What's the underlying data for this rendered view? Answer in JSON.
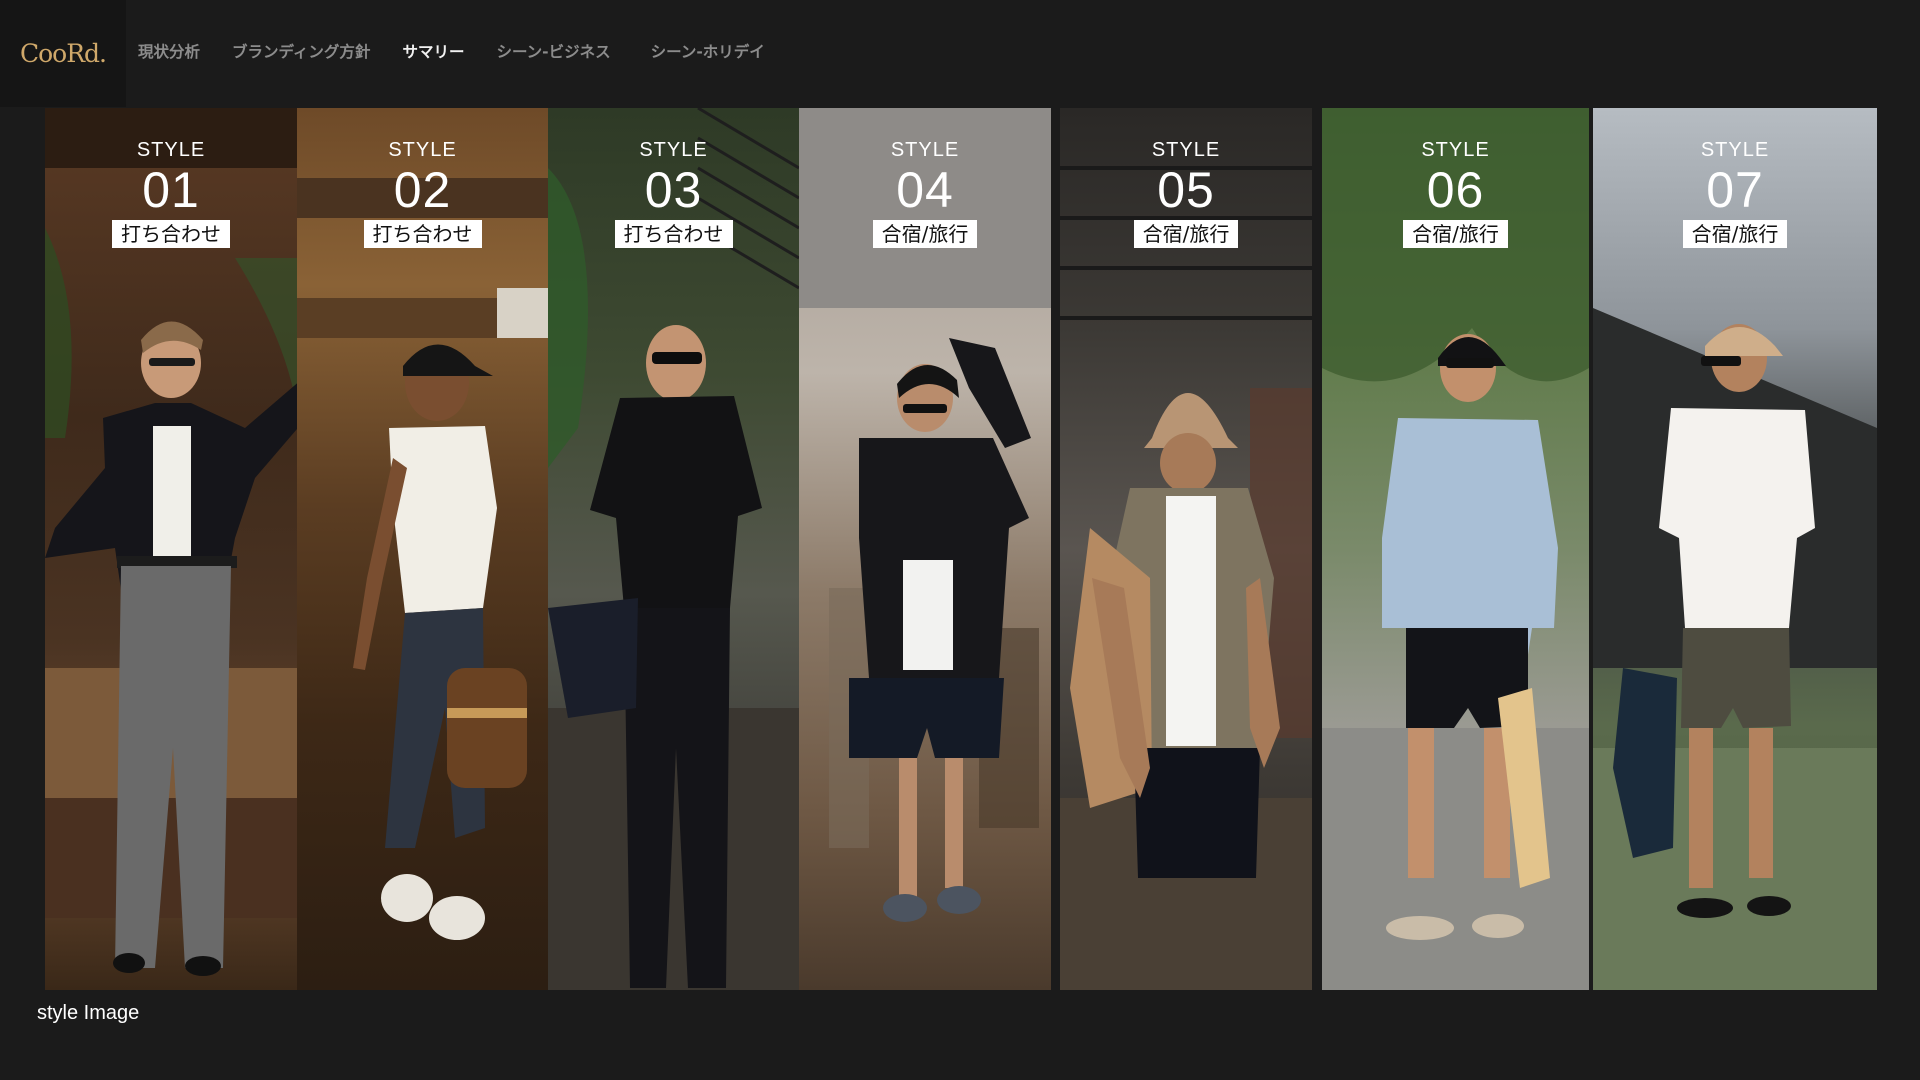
{
  "header": {
    "logo": "CooRd.",
    "nav": [
      {
        "label": "現状分析"
      },
      {
        "label": "ブランディング方針"
      },
      {
        "label": "サマリー"
      },
      {
        "label": "シーン-ビジネス"
      },
      {
        "label": "シーン-ホリデイ"
      }
    ],
    "active_index": 2
  },
  "styles": [
    {
      "word": "STYLE",
      "number": "01",
      "scene": "打ち合わせ"
    },
    {
      "word": "STYLE",
      "number": "02",
      "scene": "打ち合わせ"
    },
    {
      "word": "STYLE",
      "number": "03",
      "scene": "打ち合わせ"
    },
    {
      "word": "STYLE",
      "number": "04",
      "scene": "合宿/旅行"
    },
    {
      "word": "STYLE",
      "number": "05",
      "scene": "合宿/旅行"
    },
    {
      "word": "STYLE",
      "number": "06",
      "scene": "合宿/旅行"
    },
    {
      "word": "STYLE",
      "number": "07",
      "scene": "合宿/旅行"
    }
  ],
  "caption": "style Image",
  "colors": {
    "background": "#1b1b1b",
    "logo": "#cfa86a",
    "nav_inactive": "#8c8c8c",
    "nav_active": "#f2f2f2"
  }
}
